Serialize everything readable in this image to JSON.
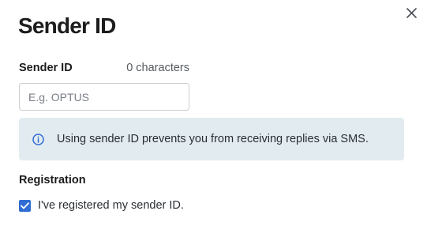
{
  "dialog": {
    "title": "Sender ID",
    "close_icon": "close-icon"
  },
  "sender_id_field": {
    "label": "Sender ID",
    "char_count": "0 characters",
    "value": "",
    "placeholder": "E.g. OPTUS"
  },
  "info_banner": {
    "icon": "info-icon",
    "text": "Using sender ID prevents you from receiving replies via SMS."
  },
  "registration": {
    "label": "Registration",
    "checkbox_label": "I've registered my sender ID.",
    "checked": true
  },
  "colors": {
    "accent": "#2f6cd3",
    "banner_bg": "#e2ebf0"
  }
}
